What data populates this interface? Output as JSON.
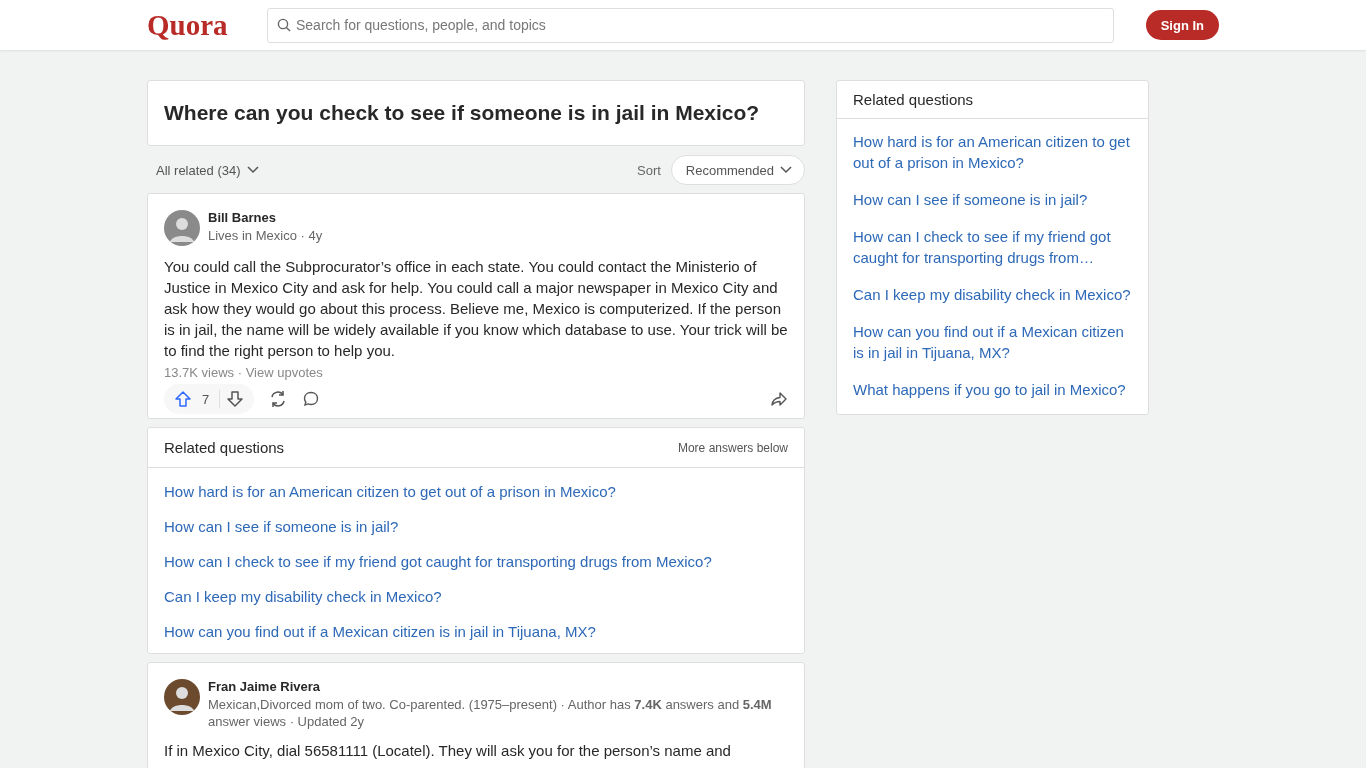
{
  "header": {
    "logo": "Quora",
    "search": {
      "placeholder": "Search for questions, people, and topics"
    },
    "sign_in": "Sign In"
  },
  "question": {
    "title": "Where can you check to see if someone is in jail in Mexico?"
  },
  "filter": {
    "all_related": "All related (34)",
    "sort_label": "Sort",
    "sort_value": "Recommended"
  },
  "answers": [
    {
      "author": "Bill Barnes",
      "meta": "Lives in Mexico · 4y",
      "body": "You could call the Subprocurator’s office in each state. You could contact the Ministerio of Justice in Mexico City and ask for help. You could call a major newspaper in Mexico City and ask how they would go about this process. Believe me, Mexico is computerized. If the person is in jail, the name will be widely available if you know which database to use. Your trick will be to find the right person to help you.",
      "views": "13.7K views · View upvotes",
      "upvotes": "7"
    },
    {
      "author": "Fran Jaime Rivera",
      "meta": "Mexican,Divorced mom of two. Co-parented. (1975–present) · Author has **7.4K** answers and **5.4M** answer views · Updated 2y",
      "body": "If in Mexico City, dial 56581111 (Locatel). They will ask you for the person’s name and"
    }
  ],
  "related_inline": {
    "title": "Related questions",
    "more": "More answers below",
    "items": [
      "How hard is for an American citizen to get out of a prison in Mexico?",
      "How can I see if someone is in jail?",
      "How can I check to see if my friend got caught for transporting drugs from Mexico?",
      "Can I keep my disability check in Mexico?",
      "How can you find out if a Mexican citizen is in jail in Tijuana, MX?"
    ]
  },
  "sidebar": {
    "title": "Related questions",
    "items": [
      "How hard is for an American citizen to get out of a prison in Mexico?",
      "How can I see if someone is in jail?",
      "How can I check to see if my friend got caught for transporting drugs from…",
      "Can I keep my disability check in Mexico?",
      "How can you find out if a Mexican citizen is in jail in Tijuana, MX?",
      "What happens if you go to jail in Mexico?"
    ]
  }
}
